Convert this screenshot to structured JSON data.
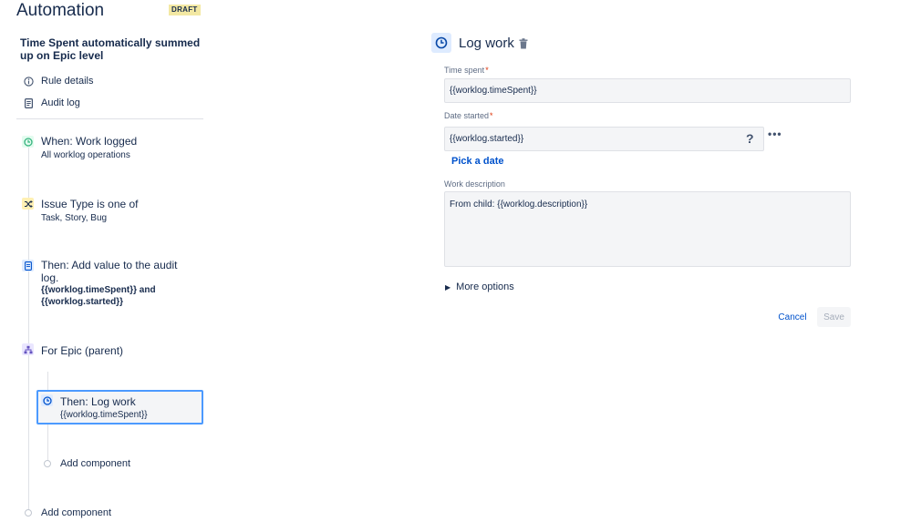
{
  "header": {
    "title": "Automation",
    "badge": "DRAFT"
  },
  "rule": {
    "title": "Time Spent automatically summed up on Epic level",
    "links": [
      {
        "label": "Rule details",
        "icon": "info-icon"
      },
      {
        "label": "Audit log",
        "icon": "document-icon"
      }
    ]
  },
  "steps": {
    "trigger": {
      "title": "When: Work logged",
      "sub": "All worklog operations",
      "icon": "clock-icon",
      "color": "#36b37e"
    },
    "condition": {
      "title": "Issue Type is one of",
      "sub": "Task, Story, Bug",
      "icon": "shuffle-icon",
      "color": "#ffab00"
    },
    "audit": {
      "title1": "Then: Add value to the audit",
      "title2": "log.",
      "sub1": "{{worklog.timeSpent}} and",
      "sub2": "{{worklog.started}}",
      "icon": "document-icon",
      "color": "#0052cc"
    },
    "branch": {
      "title": "For Epic (parent)",
      "icon": "hierarchy-icon",
      "color": "#6554c0"
    },
    "logwork": {
      "title": "Then: Log work",
      "sub": "{{worklog.timeSpent}}",
      "icon": "clock-icon",
      "color": "#0052cc"
    },
    "add_inner": "Add component",
    "add_outer": "Add component"
  },
  "form": {
    "title": "Log work",
    "time_spent": {
      "label": "Time spent",
      "required": "*",
      "value": "{{worklog.timeSpent}}"
    },
    "date_started": {
      "label": "Date started",
      "required": "*",
      "value": "{{worklog.started}}",
      "help": "?",
      "more": "•••"
    },
    "pick_date": "Pick a date",
    "work_description": {
      "label": "Work description",
      "value": "From child: {{worklog.description}}"
    },
    "more_options": "More options",
    "cancel": "Cancel",
    "save": "Save"
  },
  "colors": {
    "accent": "#0052cc",
    "selected_border": "#4c9aff",
    "badge_bg": "#f3e8a3"
  }
}
